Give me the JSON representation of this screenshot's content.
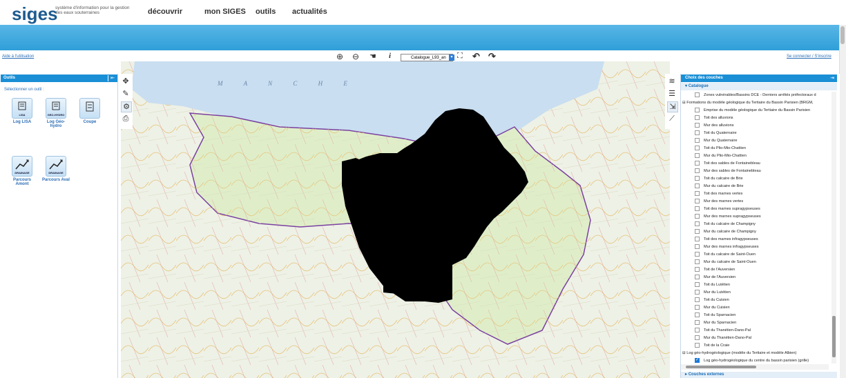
{
  "header": {
    "logo": "siges",
    "tagline": "système d'information pour la gestion des eaux souterraines",
    "nav": [
      "découvrir",
      "mon SIGES",
      "outils",
      "actualités"
    ]
  },
  "toolbar": {
    "help": "Aide à l'utilisation",
    "login": "Se connecter / S'inscrire",
    "catalog": "Catalogue_L93_an",
    "tools": [
      {
        "icon": "zoom-in-icon",
        "glyph": "⊕"
      },
      {
        "icon": "zoom-out-icon",
        "glyph": "⊖"
      },
      {
        "icon": "pan-hand-icon",
        "glyph": "☚"
      },
      {
        "icon": "info-icon",
        "glyph": "i"
      },
      {
        "icon": "full-extent-icon",
        "glyph": "⛶"
      },
      {
        "icon": "undo-icon",
        "glyph": "↶"
      },
      {
        "icon": "redo-icon",
        "glyph": "↷"
      }
    ]
  },
  "outils": {
    "title": "Outils",
    "select_label": "Sélectionner un outil :",
    "tools": [
      {
        "label": "Log LISA",
        "badge": "LISA"
      },
      {
        "label": "Log Géo-hydro",
        "badge": "GEO-HYDRO"
      },
      {
        "label": "Coupe",
        "badge": ""
      },
      {
        "label": "Parcours Amont",
        "badge": "DRAINAGE"
      },
      {
        "label": "Parcours Aval",
        "badge": "DRAINAGE"
      }
    ]
  },
  "map": {
    "sea_label": "M A N C H E"
  },
  "layers": {
    "title": "Choix des couches",
    "catalog_label": "Catalogue",
    "external_label": "Couches externes",
    "rows": [
      {
        "text": "Zones vulnérables/Bassins DCE - Derniers arrêtés préfectoraux d",
        "type": "item",
        "checked": false
      },
      {
        "text": "Formations du modèle géologique du Tertiaire du Bassin Parisien (BRGM,",
        "type": "group"
      },
      {
        "text": "Emprise du modèle géologique du Tertiaire du Bassin Parisien",
        "type": "item",
        "checked": false
      },
      {
        "text": "Toit des alluvions",
        "type": "item",
        "checked": false
      },
      {
        "text": "Mur des alluvions",
        "type": "item",
        "checked": false
      },
      {
        "text": "Toit du Quaternaire",
        "type": "item",
        "checked": false
      },
      {
        "text": "Mur du Quaternaire",
        "type": "item",
        "checked": false
      },
      {
        "text": "Toit du Plio-Mio-Chattien",
        "type": "item",
        "checked": false
      },
      {
        "text": "Mur du Plio-Mio-Chattien",
        "type": "item",
        "checked": false
      },
      {
        "text": "Toit des sables de Fontainebleau",
        "type": "item",
        "checked": false
      },
      {
        "text": "Mur des sables de Fontainebleau",
        "type": "item",
        "checked": false
      },
      {
        "text": "Toit du calcaire de Brie",
        "type": "item",
        "checked": false
      },
      {
        "text": "Mur du calcaire de Brie",
        "type": "item",
        "checked": false
      },
      {
        "text": "Toit des marnes vertes",
        "type": "item",
        "checked": false
      },
      {
        "text": "Mur des marnes vertes",
        "type": "item",
        "checked": false
      },
      {
        "text": "Toit des marnes supragypseuses",
        "type": "item",
        "checked": false
      },
      {
        "text": "Mur des marnes supragypseuses",
        "type": "item",
        "checked": false
      },
      {
        "text": "Toit du calcaire de Champigny",
        "type": "item",
        "checked": false
      },
      {
        "text": "Mur du calcaire de Champigny",
        "type": "item",
        "checked": false
      },
      {
        "text": "Toit des marnes infragypseuses",
        "type": "item",
        "checked": false
      },
      {
        "text": "Mur des marnes infragypseuses",
        "type": "item",
        "checked": false
      },
      {
        "text": "Toit du calcaire de Saint-Ouen",
        "type": "item",
        "checked": false
      },
      {
        "text": "Mur du calcaire de Saint-Ouen",
        "type": "item",
        "checked": false
      },
      {
        "text": "Toit de l'Auversien",
        "type": "item",
        "checked": false
      },
      {
        "text": "Mur de l'Auversien",
        "type": "item",
        "checked": false
      },
      {
        "text": "Toit du Lutétien",
        "type": "item",
        "checked": false
      },
      {
        "text": "Mur du Lutétien",
        "type": "item",
        "checked": false
      },
      {
        "text": "Toit du Cuisien",
        "type": "item",
        "checked": false
      },
      {
        "text": "Mur du Cuisien",
        "type": "item",
        "checked": false
      },
      {
        "text": "Toit du Sparnacien",
        "type": "item",
        "checked": false
      },
      {
        "text": "Mur du Sparnacien",
        "type": "item",
        "checked": false
      },
      {
        "text": "Toit du Thanétien-Dano-Pal",
        "type": "item",
        "checked": false
      },
      {
        "text": "Mur du Thanétien-Dano-Pal",
        "type": "item",
        "checked": false
      },
      {
        "text": "Toit de la Craie",
        "type": "item",
        "checked": false
      },
      {
        "text": "Log géo-hydrogéologique (modèle du Tertiaire et modèle Albien)",
        "type": "group"
      },
      {
        "text": "Log géo-hydrogéologique du centre du bassin parisien (grille)",
        "type": "item",
        "checked": true
      }
    ]
  },
  "colors": {
    "accent": "#1a8fd6",
    "banner": "#3aa8dd",
    "region_border": "#7a3fa0",
    "redacted": "#000000"
  }
}
